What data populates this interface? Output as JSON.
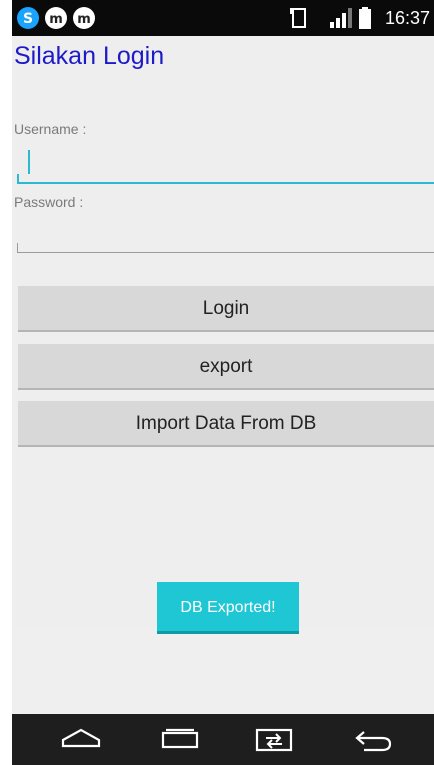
{
  "status_bar": {
    "time": "16:37",
    "left_icons": [
      "s-app-icon",
      "messaging-app-icon",
      "m-app-icon"
    ],
    "right_icons": [
      "nfc-icon",
      "signal-icon",
      "battery-icon"
    ]
  },
  "login": {
    "title": "Silakan Login",
    "username_label": "Username :",
    "username_value": "",
    "password_label": "Password :",
    "password_value": ""
  },
  "buttons": {
    "login": "Login",
    "export": "export",
    "import": "Import Data From DB"
  },
  "toast": {
    "message": "DB Exported!"
  },
  "nav_bar": {
    "icons": [
      "home-icon",
      "recents-icon",
      "switch-app-icon",
      "back-icon"
    ]
  },
  "colors": {
    "title": "#1d1ac8",
    "accent": "#2bbad0",
    "toast": "#1fc6d4",
    "button": "#d8d8d8"
  }
}
